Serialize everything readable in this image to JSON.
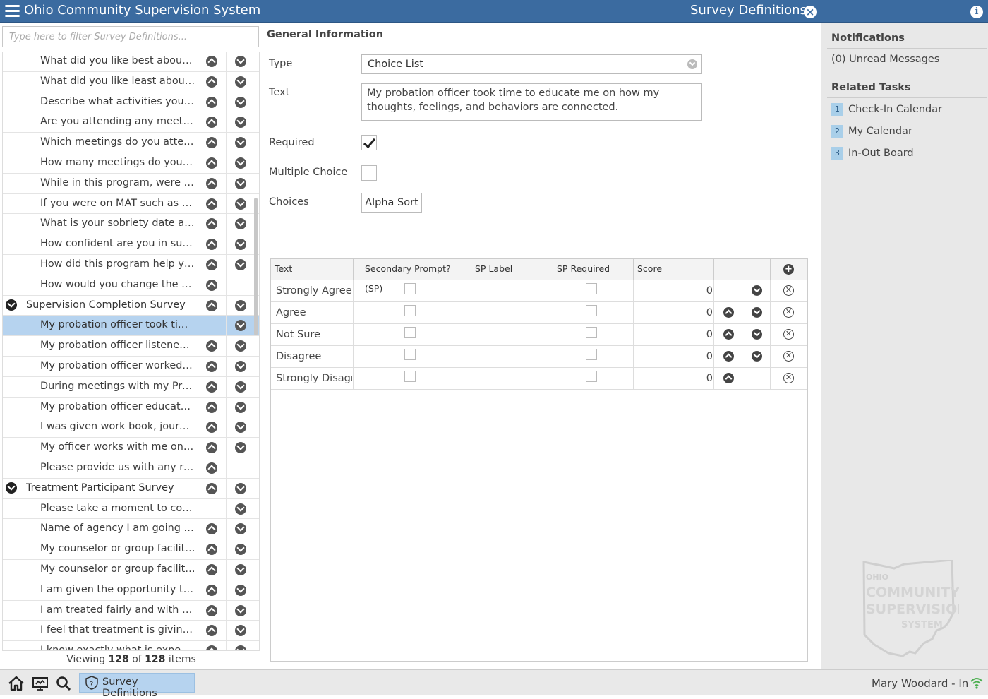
{
  "header": {
    "app_title": "Ohio Community Supervision System",
    "page_title": "Survey Definitions",
    "close_glyph": "×",
    "info_glyph": "i"
  },
  "left": {
    "filter_placeholder": "Type here to filter Survey Definitions...",
    "viewing_prefix": "Viewing",
    "viewing_shown": "128",
    "viewing_of": "of",
    "viewing_total": "128",
    "viewing_suffix": "items",
    "rows": [
      {
        "text": "What did you like best about th...",
        "type": "item",
        "up": true,
        "down": true
      },
      {
        "text": "What did you like least about t...",
        "type": "item",
        "up": true,
        "down": true
      },
      {
        "text": "Describe what activities you cu...",
        "type": "item",
        "up": true,
        "down": true
      },
      {
        "text": "Are you attending any meetings?",
        "type": "item",
        "up": true,
        "down": true
      },
      {
        "text": "Which meetings do you attend?",
        "type": "item",
        "up": true,
        "down": true
      },
      {
        "text": "How many meetings do you att...",
        "type": "item",
        "up": true,
        "down": true
      },
      {
        "text": "While in this program, were yo...",
        "type": "item",
        "up": true,
        "down": true
      },
      {
        "text": "If you were on MAT such as Vivi...",
        "type": "item",
        "up": true,
        "down": true
      },
      {
        "text": "What is your sobriety date and ...",
        "type": "item",
        "up": true,
        "down": true
      },
      {
        "text": "How confident are you in succe...",
        "type": "item",
        "up": true,
        "down": true
      },
      {
        "text": "How did this program help you...",
        "type": "item",
        "up": true,
        "down": true
      },
      {
        "text": "How would you change the Me...",
        "type": "item",
        "up": true,
        "down": false
      },
      {
        "text": "Supervision Completion Survey",
        "type": "group",
        "up": true,
        "down": true
      },
      {
        "text": "My probation officer took time ...",
        "type": "item",
        "up": false,
        "down": true,
        "selected": true
      },
      {
        "text": "My probation officer listened t...",
        "type": "item",
        "up": true,
        "down": true
      },
      {
        "text": "My probation officer worked wi...",
        "type": "item",
        "up": true,
        "down": true
      },
      {
        "text": "During meetings with my Prob...",
        "type": "item",
        "up": true,
        "down": true
      },
      {
        "text": "My probation officer educated ...",
        "type": "item",
        "up": true,
        "down": true
      },
      {
        "text": "I was given work book, journali...",
        "type": "item",
        "up": true,
        "down": true
      },
      {
        "text": "My officer works with me on de...",
        "type": "item",
        "up": true,
        "down": true
      },
      {
        "text": "Please provide us with any rec...",
        "type": "item",
        "up": true,
        "down": false
      },
      {
        "text": "Treatment Participant Survey",
        "type": "group",
        "up": true,
        "down": true
      },
      {
        "text": "Please take a moment to comp...",
        "type": "item",
        "up": false,
        "down": true
      },
      {
        "text": "Name of agency I am going to:",
        "type": "item",
        "up": true,
        "down": true
      },
      {
        "text": "My counselor or group facilitat...",
        "type": "item",
        "up": true,
        "down": true
      },
      {
        "text": "My counselor or group facilitat...",
        "type": "item",
        "up": true,
        "down": true
      },
      {
        "text": "I am given the opportunity to d...",
        "type": "item",
        "up": true,
        "down": true
      },
      {
        "text": "I am treated fairly and with res...",
        "type": "item",
        "up": true,
        "down": true
      },
      {
        "text": "I feel that treatment is giving m...",
        "type": "item",
        "up": true,
        "down": true
      },
      {
        "text": "I know exactly what is expected ...",
        "type": "item",
        "up": true,
        "down": true
      }
    ]
  },
  "main": {
    "section_title": "General Information",
    "type_label": "Type",
    "type_value": "Choice List",
    "text_label": "Text",
    "text_value": "My probation officer took time to educate me on how my thoughts, feelings, and behaviors are connected.",
    "required_label": "Required",
    "required_checked": true,
    "multiple_label": "Multiple Choice",
    "multiple_checked": false,
    "choices_label": "Choices",
    "alpha_sort_label": "Alpha Sort",
    "grid_headers": [
      "Text",
      "Secondary Prompt? (SP)",
      "SP Label",
      "SP Required",
      "Score"
    ],
    "add_glyph": "+",
    "choices": [
      {
        "text": "Strongly Agree",
        "score": "0",
        "up": false,
        "down": true
      },
      {
        "text": "Agree",
        "score": "0",
        "up": true,
        "down": true
      },
      {
        "text": "Not Sure",
        "score": "0",
        "up": true,
        "down": true
      },
      {
        "text": "Disagree",
        "score": "0",
        "up": true,
        "down": true
      },
      {
        "text": "Strongly Disagree",
        "score": "0",
        "up": true,
        "down": false
      }
    ]
  },
  "right": {
    "notifications_title": "Notifications",
    "unread_messages": "(0) Unread Messages",
    "related_title": "Related Tasks",
    "tasks": [
      {
        "num": "1",
        "label": "Check-In Calendar"
      },
      {
        "num": "2",
        "label": "My Calendar"
      },
      {
        "num": "3",
        "label": "In-Out Board"
      }
    ],
    "watermark_lines": [
      "OHIO",
      "COMMUNITY",
      "SUPERVISION",
      "SYSTEM"
    ]
  },
  "footer": {
    "icons": [
      "home-icon",
      "monitor-icon",
      "search-icon"
    ],
    "tab_label": "Survey Definitions",
    "tab_icon": "shield-question-icon",
    "user_status": "Mary Woodard - In",
    "signal_icon": "wifi-icon"
  },
  "colors": {
    "titlebar": "#3b6ba0",
    "selected_row": "#b6d3ef",
    "right_panel": "#e8e8e8"
  }
}
